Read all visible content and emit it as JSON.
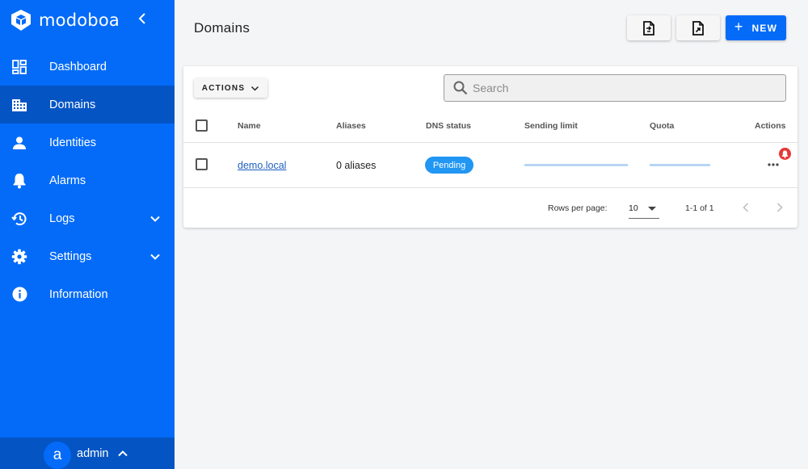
{
  "app": {
    "brand": "modoboa",
    "accent_color": "#046bf8",
    "active_color": "#0454c4"
  },
  "sidebar": {
    "items": [
      {
        "label": "Dashboard",
        "icon": "dashboard-icon"
      },
      {
        "label": "Domains",
        "icon": "domain-icon",
        "active": true
      },
      {
        "label": "Identities",
        "icon": "user-icon"
      },
      {
        "label": "Alarms",
        "icon": "bell-icon"
      },
      {
        "label": "Logs",
        "icon": "history-icon",
        "expandable": true
      },
      {
        "label": "Settings",
        "icon": "gear-icon",
        "expandable": true
      },
      {
        "label": "Information",
        "icon": "info-icon"
      }
    ],
    "user": {
      "avatar_letter": "a",
      "name": "admin"
    }
  },
  "header": {
    "title": "Domains",
    "import_icon": "file-import-icon",
    "export_icon": "file-export-icon",
    "new_label": "NEW",
    "new_plus": "+"
  },
  "toolbar": {
    "actions_label": "ACTIONS",
    "search_placeholder": "Search"
  },
  "table": {
    "columns": [
      "Name",
      "Aliases",
      "DNS status",
      "Sending limit",
      "Quota",
      "Actions"
    ],
    "rows": [
      {
        "name": "demo.local",
        "aliases": "0 aliases",
        "dns_status": "Pending",
        "sending_limit_used": 0,
        "quota_used": 0,
        "has_alert": true
      }
    ]
  },
  "footer": {
    "rows_per_page_label": "Rows per page:",
    "rows_per_page_value": "10",
    "range": "1-1 of 1"
  }
}
